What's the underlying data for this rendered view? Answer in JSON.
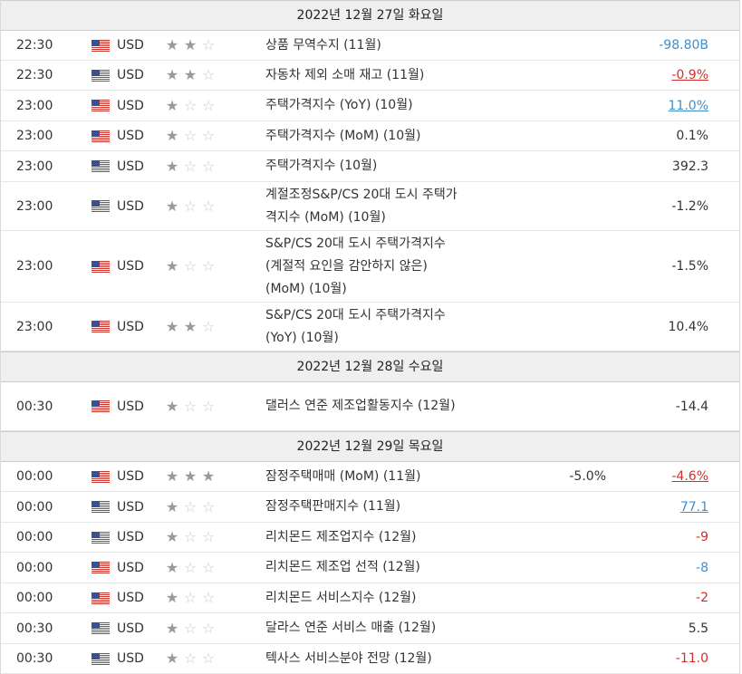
{
  "colors": {
    "header_bg": "#efefef",
    "red": "#d0302c",
    "blue": "#3d8fcf",
    "star_on": "#999999",
    "star_off": "#c9c9c9"
  },
  "sections": [
    {
      "date": "2022년 12월 27일 화요일",
      "rows": [
        {
          "time": "22:30",
          "currency": "USD",
          "importance": 2,
          "event": "상품 무역수지 (11월)",
          "forecast": "",
          "actual": "-98.80B",
          "style": "blue",
          "height": 32
        },
        {
          "time": "22:30",
          "currency": "USD",
          "importance": 2,
          "event": "자동차 제외 소매 재고 (11월)",
          "forecast": "",
          "actual": "-0.9%",
          "style": "ured",
          "height": 32
        },
        {
          "time": "23:00",
          "currency": "USD",
          "importance": 1,
          "event": "주택가격지수 (YoY) (10월)",
          "forecast": "",
          "actual": "11.0%",
          "style": "ublue",
          "height": 33
        },
        {
          "time": "23:00",
          "currency": "USD",
          "importance": 1,
          "event": "주택가격지수 (MoM) (10월)",
          "forecast": "",
          "actual": "0.1%",
          "style": "",
          "height": 32
        },
        {
          "time": "23:00",
          "currency": "USD",
          "importance": 1,
          "event": "주택가격지수 (10월)",
          "forecast": "",
          "actual": "392.3",
          "style": "",
          "height": 33
        },
        {
          "time": "23:00",
          "currency": "USD",
          "importance": 1,
          "event": "계절조정S&P/CS 20대 도시 주택가격지수 (MoM) (10월)",
          "forecast": "",
          "actual": "-1.2%",
          "style": "",
          "height": 53
        },
        {
          "time": "23:00",
          "currency": "USD",
          "importance": 1,
          "event": "S&P/CS 20대 도시 주택가격지수(계절적 요인을 감안하지 않은) (MoM) (10월)",
          "forecast": "",
          "actual": "-1.5%",
          "style": "",
          "height": 78
        },
        {
          "time": "23:00",
          "currency": "USD",
          "importance": 2,
          "event": "S&P/CS 20대 도시 주택가격지수 (YoY) (10월)",
          "forecast": "",
          "actual": "10.4%",
          "style": "",
          "height": 53
        }
      ]
    },
    {
      "date": "2022년 12월 28일 수요일",
      "rows": [
        {
          "time": "00:30",
          "currency": "USD",
          "importance": 1,
          "event": "댈러스 연준 제조업활동지수 (12월)",
          "forecast": "",
          "actual": "-14.4",
          "style": "",
          "height": 53
        }
      ]
    },
    {
      "date": "2022년 12월 29일 목요일",
      "rows": [
        {
          "time": "00:00",
          "currency": "USD",
          "importance": 3,
          "event": "잠정주택매매 (MoM) (11월)",
          "forecast": "-5.0%",
          "actual": "-4.6%",
          "style": "ured",
          "height": 32
        },
        {
          "time": "00:00",
          "currency": "USD",
          "importance": 1,
          "event": "잠정주택판매지수 (11월)",
          "forecast": "",
          "actual": "77.1",
          "style": "ublue",
          "height": 33
        },
        {
          "time": "00:00",
          "currency": "USD",
          "importance": 1,
          "event": "리치몬드 제조업지수 (12월)",
          "forecast": "",
          "actual": "-9",
          "style": "red",
          "height": 32
        },
        {
          "time": "00:00",
          "currency": "USD",
          "importance": 1,
          "event": "리치몬드 제조업 선적 (12월)",
          "forecast": "",
          "actual": "-8",
          "style": "blue",
          "height": 33
        },
        {
          "time": "00:00",
          "currency": "USD",
          "importance": 1,
          "event": "리치몬드 서비스지수 (12월)",
          "forecast": "",
          "actual": "-2",
          "style": "red",
          "height": 32
        },
        {
          "time": "00:30",
          "currency": "USD",
          "importance": 1,
          "event": "달라스 연준 서비스 매출 (12월)",
          "forecast": "",
          "actual": "5.5",
          "style": "",
          "height": 33
        },
        {
          "time": "00:30",
          "currency": "USD",
          "importance": 1,
          "event": "텍사스 서비스분야 전망 (12월)",
          "forecast": "",
          "actual": "-11.0",
          "style": "red",
          "height": 32
        }
      ]
    }
  ]
}
